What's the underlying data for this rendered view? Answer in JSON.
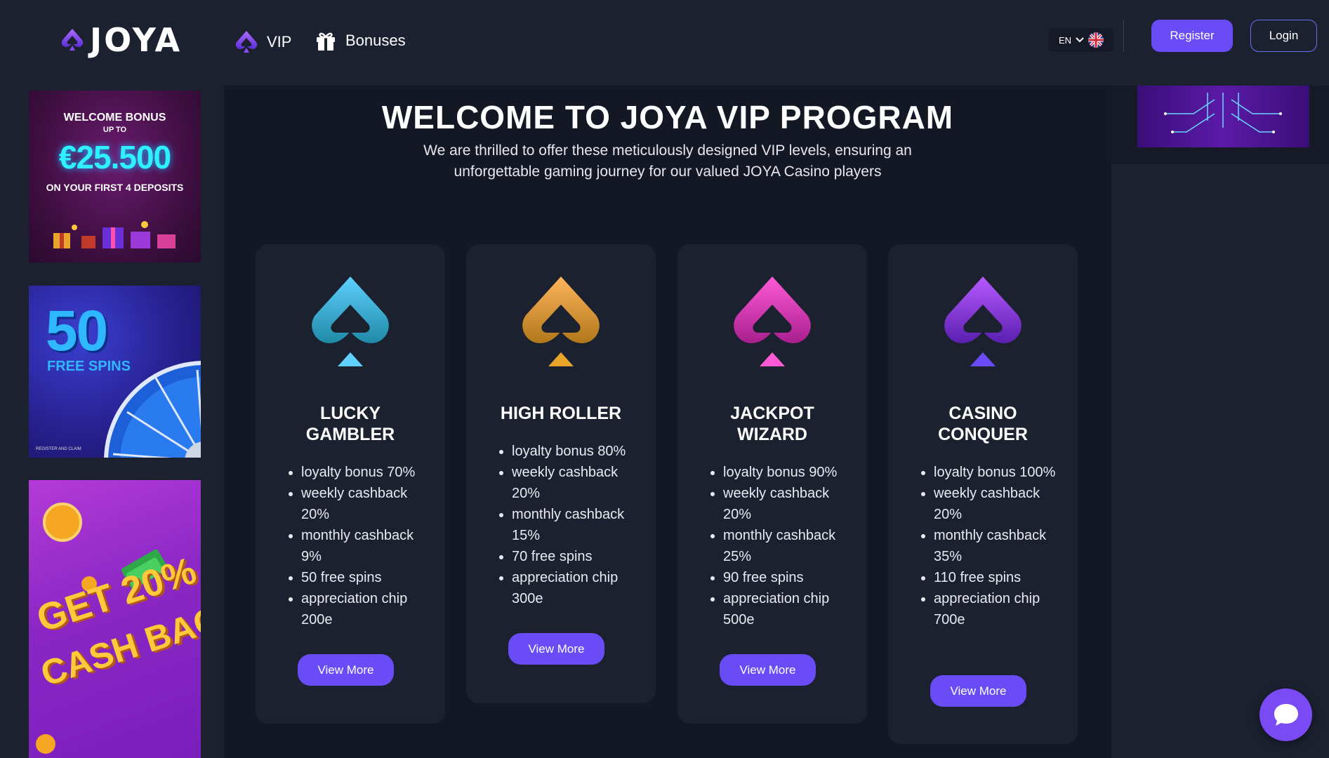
{
  "header": {
    "logo_text": "JOYA",
    "nav": [
      {
        "label": "VIP",
        "icon": "spade-icon"
      },
      {
        "label": "Bonuses",
        "icon": "gift-icon"
      }
    ],
    "language": "EN",
    "register_label": "Register",
    "login_label": "Login"
  },
  "banners": {
    "welcome": {
      "line1": "WELCOME BONUS",
      "line2": "UP TO",
      "amount": "€25.500",
      "line3": "ON YOUR FIRST 4 DEPOSITS"
    },
    "free_spins": {
      "number": "50",
      "text": "FREE SPINS",
      "small": "REGISTER AND CLAIM"
    },
    "cashback": {
      "line1": "GET 20%",
      "line2": "CASH BACK"
    }
  },
  "main": {
    "title": "WELCOME TO JOYA VIP PROGRAM",
    "subtitle": "We are thrilled to offer these meticulously designed VIP levels, ensuring an unforgettable gaming journey for our valued JOYA Casino players",
    "cards": [
      {
        "title": "LUCKY GAMBLER",
        "color_top": "#5fd0ff",
        "color_bottom": "#1f8aa6",
        "items": [
          "loyalty bonus 70%",
          "weekly cashback 20%",
          "monthly cashback 9%",
          "50 free spins",
          "appreciation chip 200e"
        ],
        "button": "View More"
      },
      {
        "title": "HIGH ROLLER",
        "color_top": "#ffb45a",
        "color_bottom": "#b0781a",
        "items": [
          "loyalty bonus 80%",
          "weekly cashback 20%",
          "monthly cashback 15%",
          "70 free spins",
          "appreciation chip 300e"
        ],
        "button": "View More"
      },
      {
        "title": "JACKPOT WIZARD",
        "color_top": "#ff5ad6",
        "color_bottom": "#a81f8e",
        "items": [
          "loyalty bonus 90%",
          "weekly cashback 20%",
          "monthly cashback 25%",
          "90 free spins",
          "appreciation chip 500e"
        ],
        "button": "View More"
      },
      {
        "title": "CASINO CONQUER",
        "color_top": "#b85aff",
        "color_bottom": "#5a1fb0",
        "items": [
          "loyalty bonus 100%",
          "weekly cashback 20%",
          "monthly cashback 35%",
          "110 free spins",
          "appreciation chip 700e"
        ],
        "button": "View More"
      }
    ]
  },
  "colors": {
    "accent": "#6a4cf6",
    "background": "#1c2130",
    "panel": "#141824"
  }
}
